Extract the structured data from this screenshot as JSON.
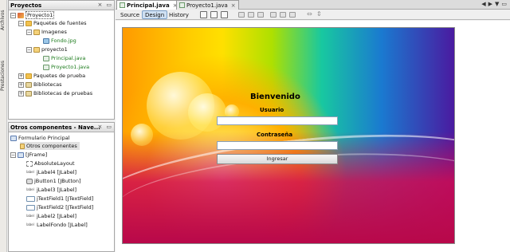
{
  "side_strip": {
    "tab1": "Archivos",
    "tab2": "Prestaciones"
  },
  "projects_panel": {
    "title": "Proyectos",
    "tree": [
      {
        "label": "Proyecto1"
      },
      {
        "label": "Paquetes de fuentes"
      },
      {
        "label": "Imagenes"
      },
      {
        "label": "Fondo.jpg"
      },
      {
        "label": "proyecto1"
      },
      {
        "label": "Principal.java"
      },
      {
        "label": "Proyecto1.java"
      },
      {
        "label": "Paquetes de prueba"
      },
      {
        "label": "Bibliotecas"
      },
      {
        "label": "Bibliotecas de pruebas"
      }
    ]
  },
  "components_panel": {
    "title": "Otros componentes - Nave...",
    "tree": [
      {
        "label": "Formulario Principal"
      },
      {
        "label": "Otros componentes"
      },
      {
        "label": "[JFrame]"
      },
      {
        "label": "AbsoluteLayout"
      },
      {
        "label": "jLabel4 [JLabel]"
      },
      {
        "label": "jButton1 [JButton]"
      },
      {
        "label": "jLabel3 [JLabel]"
      },
      {
        "label": "jTextField1 [JTextField]"
      },
      {
        "label": "jTextField2 [JTextField]"
      },
      {
        "label": "jLabel2 [JLabel]"
      },
      {
        "label": "LabelFondo [JLabel]"
      }
    ]
  },
  "editor": {
    "tabs": [
      {
        "label": "Principal.java"
      },
      {
        "label": "Proyecto1.java"
      }
    ],
    "toolbar": {
      "source": "Source",
      "design": "Design",
      "history": "History"
    }
  },
  "form": {
    "title": "Bienvenido",
    "usuario_label": "Usuario",
    "password_label": "Contraseña",
    "button_label": "Ingresar"
  }
}
